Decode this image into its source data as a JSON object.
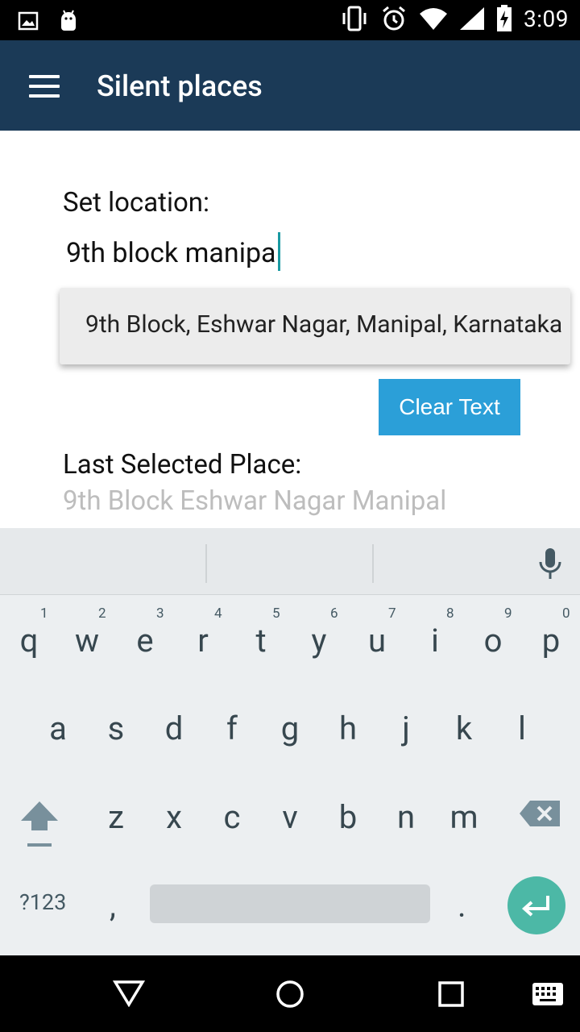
{
  "status_bar": {
    "time": "3:09",
    "left_icons": [
      "image-notification-icon",
      "android-debug-icon"
    ],
    "right_icons": [
      "vibrate-icon",
      "alarm-icon",
      "wifi-icon",
      "signal-icon",
      "battery-charging-icon"
    ]
  },
  "app_bar": {
    "title": "Silent places",
    "menu_icon": "hamburger-menu-icon"
  },
  "form": {
    "set_location_label": "Set location:",
    "location_input_value": "9th block manipa",
    "suggestion": "9th Block, Eshwar Nagar, Manipal, Karnataka",
    "clear_button_label": "Clear Text",
    "last_selected_label": "Last Selected Place:",
    "last_selected_value": "9th Block Eshwar Nagar Manipal"
  },
  "colors": {
    "app_bar": "#1b3a57",
    "button": "#2b9fd8",
    "cursor": "#1b9aa2",
    "enter_key": "#4cb8a6"
  },
  "keyboard": {
    "row1": [
      "q",
      "w",
      "e",
      "r",
      "t",
      "y",
      "u",
      "i",
      "o",
      "p"
    ],
    "row1_hints": [
      "1",
      "2",
      "3",
      "4",
      "5",
      "6",
      "7",
      "8",
      "9",
      "0"
    ],
    "row2": [
      "a",
      "s",
      "d",
      "f",
      "g",
      "h",
      "j",
      "k",
      "l"
    ],
    "row3": [
      "z",
      "x",
      "c",
      "v",
      "b",
      "n",
      "m"
    ],
    "symbols_key": "?123",
    "comma_key": ",",
    "period_key": ".",
    "icons": [
      "mic-icon",
      "shift-icon",
      "backspace-icon",
      "enter-icon"
    ]
  },
  "nav_bar": {
    "icons": [
      "back-icon",
      "home-icon",
      "recents-icon",
      "keyboard-switch-icon"
    ]
  }
}
